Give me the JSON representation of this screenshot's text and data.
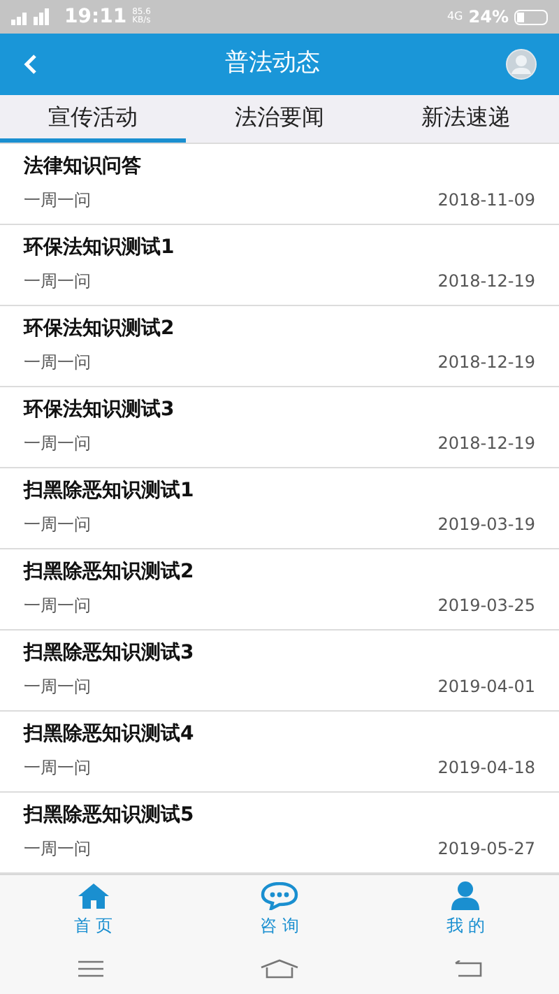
{
  "status_bar": {
    "time": "19:11",
    "speed": "85.6",
    "speed_unit": "KB/s",
    "network": "4G",
    "battery": "24%"
  },
  "header": {
    "title": "普法动态"
  },
  "tabs": [
    {
      "label": "宣传活动",
      "selected": true
    },
    {
      "label": "法治要闻",
      "selected": false
    },
    {
      "label": "新法速递",
      "selected": false
    }
  ],
  "items": [
    {
      "title": "法律知识问答",
      "subtitle": "一周一问",
      "date": "2018-11-09"
    },
    {
      "title": "环保法知识测试1",
      "subtitle": "一周一问",
      "date": "2018-12-19"
    },
    {
      "title": "环保法知识测试2",
      "subtitle": "一周一问",
      "date": "2018-12-19"
    },
    {
      "title": "环保法知识测试3",
      "subtitle": "一周一问",
      "date": "2018-12-19"
    },
    {
      "title": "扫黑除恶知识测试1",
      "subtitle": "一周一问",
      "date": "2019-03-19"
    },
    {
      "title": "扫黑除恶知识测试2",
      "subtitle": "一周一问",
      "date": "2019-03-25"
    },
    {
      "title": "扫黑除恶知识测试3",
      "subtitle": "一周一问",
      "date": "2019-04-01"
    },
    {
      "title": "扫黑除恶知识测试4",
      "subtitle": "一周一问",
      "date": "2019-04-18"
    },
    {
      "title": "扫黑除恶知识测试5",
      "subtitle": "一周一问",
      "date": "2019-05-27"
    }
  ],
  "bottom_nav": [
    {
      "label": "首 页",
      "kind": "home"
    },
    {
      "label": "咨 询",
      "kind": "chat"
    },
    {
      "label": "我 的",
      "kind": "user"
    }
  ]
}
